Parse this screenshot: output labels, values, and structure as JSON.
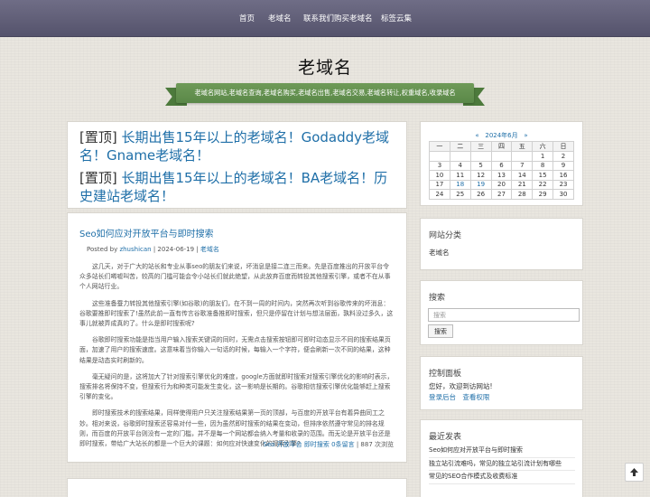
{
  "nav": {
    "items": [
      "首页",
      "老域名",
      "联系我们购买老域名",
      "标签云集"
    ]
  },
  "site": {
    "title": "老域名",
    "tagline": "老域名网站,老域名查询,老域名购买,老域名出售,老域名交易,老域名转让,权重域名,收录域名"
  },
  "sticky_posts": [
    {
      "tag": "[置顶]",
      "title": "长期出售15年以上的老域名！Godaddy老域名！Gname老域名！"
    },
    {
      "tag": "[置顶]",
      "title": "长期出售15年以上的老域名！BA老域名！历史建站老域名！"
    }
  ],
  "post": {
    "title": "Seo如何应对开放平台与即时搜索",
    "meta_prefix": "Posted by ",
    "author": "zhushican",
    "sep1": " | ",
    "date": "2024-06-19",
    "sep2": " | ",
    "category": "老域名",
    "paragraphs": [
      "这几天，对于广大的站长和专业从事seo的朋友们来说，坏消息是接二连三而来。先是百度推出的开放平台令众多站长们唏嘘叫苦，较高的门槛可能会令小站长们就此绝望，从此放弃百度而转投其他搜索引擎，或者不在从事个人网站行业。",
      "这些准备蚕力转投其他搜索引擎(如谷歌)的朋友们，在不到一周的时间内，突然再次听到谷歌传来的坏消息：谷歌要推即时搜索了!虽然此前一直有传言谷歌准备推即时搜索，但只是停留在计划与想法层面，孰料没过多久，这事儿就被弄成真的了。什么是即时搜索呢?",
      "谷歌即时搜索功能是指当用户输入搜索关键词的同时，无需点击搜索按钮即可即时动态显示不同的搜索结果页面，加速了用户的搜索速度。这意味着当你输入一句话的时候，每输入一个字符，便会刷新一次不同的结果，这种结果是动态实时刷新的。",
      "毫无疑问的是，这将加大了针对搜索引擎优化的难度，google方面就即时搜索对搜索引擎优化的影响时表示，搜索排名将保持不变，但搜索行为和种类可能发生变化，这一影响是长期的。谷歌相信搜索引擎优化能够赶上搜索引擎的变化。",
      "即时搜索技术的搜索结果，同样使得用户只关注搜索结果第一页的顶部，与百度的开放平台有着异曲同工之妙。相对来说，谷歌即时搜索还容易对付一些，因为虽然即时搜索的结果在变动，但排序依然遵守常见的排名规则，而百度的开放平台则没有一定的门槛，并不是每一个网站都会纳入考量和收录的范围。而无论是开放平台还是即时搜索，带给广大站长的都是一个巨大的课题：如何应对快速变化的搜索引擎?"
    ],
    "footer_tag1": "Seo",
    "footer_tag2": "开放平台",
    "footer_tag3": "即时搜索",
    "footer_comments": "0条留言",
    "footer_sep": " | ",
    "footer_views": "887 次浏览"
  },
  "calendar": {
    "prev": "«",
    "month": "2024年6月",
    "next": "»",
    "weekdays": [
      "一",
      "二",
      "三",
      "四",
      "五",
      "六",
      "日"
    ],
    "weeks": [
      [
        "",
        "",
        "",
        "",
        "",
        "1",
        "2"
      ],
      [
        "3",
        "4",
        "5",
        "6",
        "7",
        "8",
        "9"
      ],
      [
        "10",
        "11",
        "12",
        "13",
        "14",
        "15",
        "16"
      ],
      [
        "17",
        "18",
        "19",
        "20",
        "21",
        "22",
        "23"
      ],
      [
        "24",
        "25",
        "26",
        "27",
        "28",
        "29",
        "30"
      ]
    ],
    "linked_days": [
      "18",
      "19"
    ]
  },
  "widgets": {
    "categories": {
      "title": "网站分类",
      "item": "老域名"
    },
    "search": {
      "title": "搜索",
      "placeholder": "搜索",
      "button": "搜索"
    },
    "control": {
      "title": "控制面板",
      "greeting": "您好，欢迎到访网站!",
      "login": "登录后台",
      "permissions": "查看权限"
    },
    "recent": {
      "title": "最近发表",
      "items": [
        "Seo如何应对开放平台与即时搜索",
        "独立站引流难吗，常见的独立站引流计划有哪些",
        "常见的SEO合作模式及收费标准"
      ]
    }
  },
  "colors": {
    "nav_bg": "#605e77",
    "ribbon": "#5f8c4c",
    "link": "#1f6fa8"
  },
  "icons": {
    "back_to_top": "arrow-up-icon"
  }
}
